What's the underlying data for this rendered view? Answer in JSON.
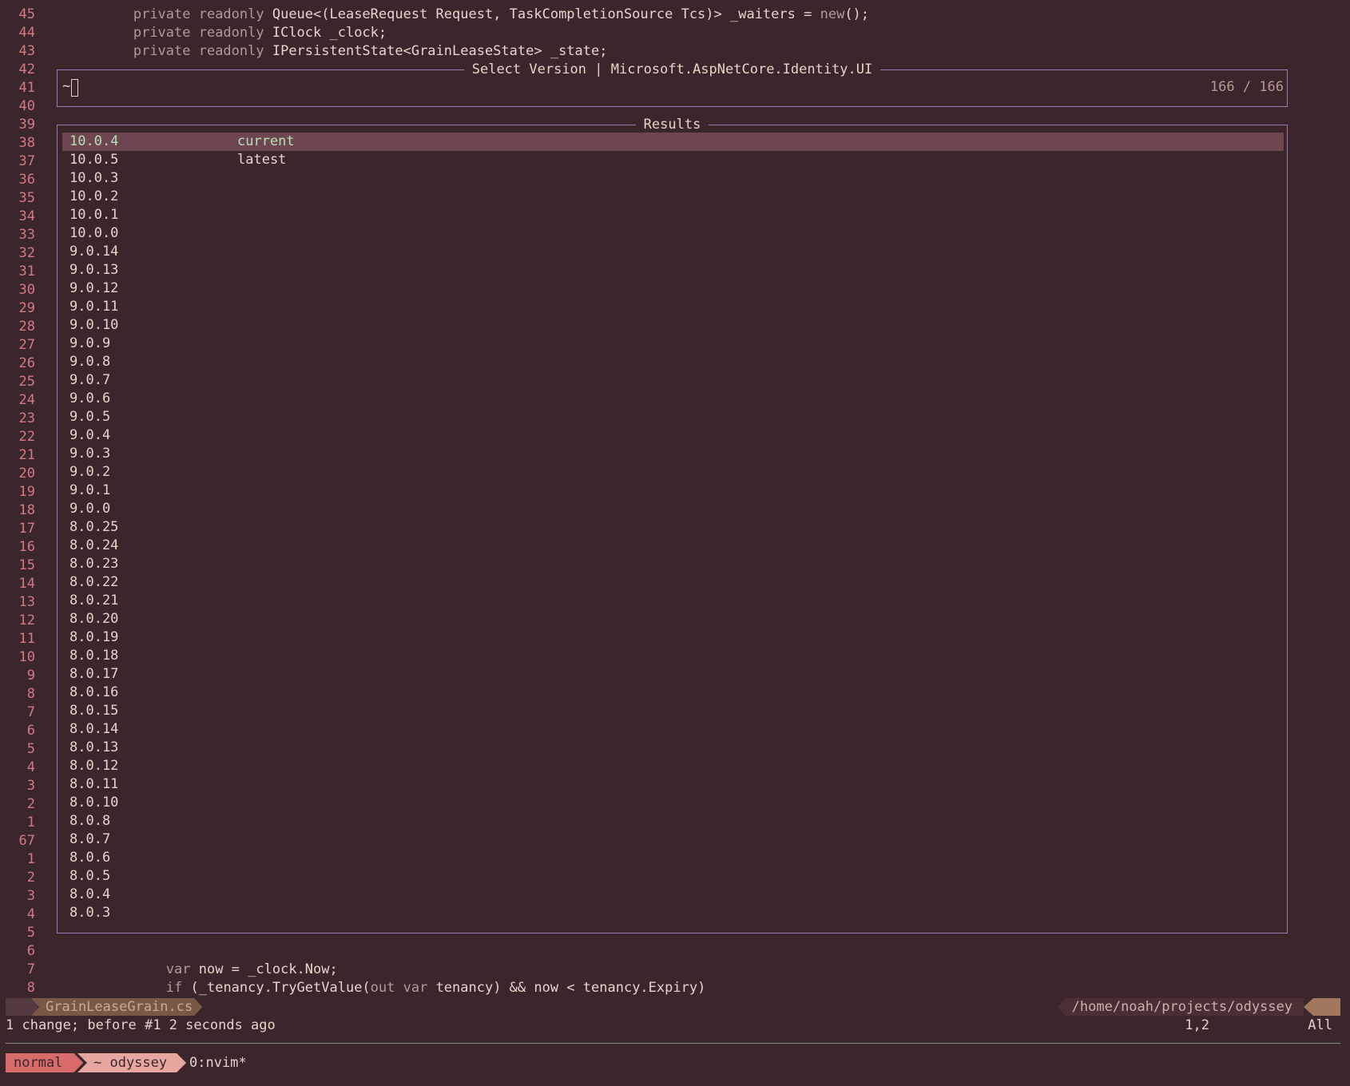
{
  "editor": {
    "code_top": [
      {
        "ln": "45",
        "indent": "    ",
        "kw": "private readonly",
        "rest": " Queue<(LeaseRequest Request, TaskCompletionSource Tcs)> _waiters = ",
        "kw2": "new",
        "tail": "();"
      },
      {
        "ln": "44",
        "indent": "    ",
        "kw": "private readonly",
        "rest": " IClock _clock;",
        "kw2": "",
        "tail": ""
      },
      {
        "ln": "43",
        "indent": "    ",
        "kw": "private readonly",
        "rest": " IPersistentState<GrainLeaseState> _state;",
        "kw2": "",
        "tail": ""
      }
    ],
    "gutter": [
      "42",
      "41",
      "40",
      "39",
      "38",
      "37",
      "36",
      "35",
      "34",
      "33",
      "32",
      "31",
      "30",
      "29",
      "28",
      "27",
      "26",
      "25",
      "24",
      "23",
      "22",
      "21",
      "20",
      "19",
      "18",
      "17",
      "16",
      "15",
      "14",
      "13",
      "12",
      "11",
      "10",
      "9",
      "8",
      "7",
      "6",
      "5",
      "4",
      "3",
      "2",
      "1",
      "67",
      "1",
      "2",
      "3",
      "4",
      "5",
      "6"
    ],
    "code_bottom": [
      {
        "ln": "7",
        "indent": "        ",
        "kw": "var",
        "rest": " now = _clock.Now;",
        "kw2": "",
        "tail": ""
      },
      {
        "ln": "8",
        "indent": "        ",
        "kw": "if",
        "rest": " (_tenancy.TryGetValue(",
        "kw2": "out var",
        "tail": " tenancy) && now < tenancy.Expiry)"
      }
    ]
  },
  "picker": {
    "title": "Select Version | Microsoft.AspNetCore.Identity.UI",
    "prompt": "~",
    "counter": "166 / 166",
    "results_title": "Results",
    "results": [
      {
        "version": "10.0.4",
        "tag": "current",
        "selected": true
      },
      {
        "version": "10.0.5",
        "tag": "latest"
      },
      {
        "version": "10.0.3"
      },
      {
        "version": "10.0.2"
      },
      {
        "version": "10.0.1"
      },
      {
        "version": "10.0.0"
      },
      {
        "version": "9.0.14"
      },
      {
        "version": "9.0.13"
      },
      {
        "version": "9.0.12"
      },
      {
        "version": "9.0.11"
      },
      {
        "version": "9.0.10"
      },
      {
        "version": "9.0.9"
      },
      {
        "version": "9.0.8"
      },
      {
        "version": "9.0.7"
      },
      {
        "version": "9.0.6"
      },
      {
        "version": "9.0.5"
      },
      {
        "version": "9.0.4"
      },
      {
        "version": "9.0.3"
      },
      {
        "version": "9.0.2"
      },
      {
        "version": "9.0.1"
      },
      {
        "version": "9.0.0"
      },
      {
        "version": "8.0.25"
      },
      {
        "version": "8.0.24"
      },
      {
        "version": "8.0.23"
      },
      {
        "version": "8.0.22"
      },
      {
        "version": "8.0.21"
      },
      {
        "version": "8.0.20"
      },
      {
        "version": "8.0.19"
      },
      {
        "version": "8.0.18"
      },
      {
        "version": "8.0.17"
      },
      {
        "version": "8.0.16"
      },
      {
        "version": "8.0.15"
      },
      {
        "version": "8.0.14"
      },
      {
        "version": "8.0.13"
      },
      {
        "version": "8.0.12"
      },
      {
        "version": "8.0.11"
      },
      {
        "version": "8.0.10"
      },
      {
        "version": "8.0.8"
      },
      {
        "version": "8.0.7"
      },
      {
        "version": "8.0.6"
      },
      {
        "version": "8.0.5"
      },
      {
        "version": "8.0.4"
      },
      {
        "version": "8.0.3"
      }
    ]
  },
  "statusline": {
    "filename": "GrainLeaseGrain.cs",
    "path": "/home/noah/projects/odyssey"
  },
  "message": {
    "text": "1 change; before #1  2 seconds ago",
    "position": "1,2",
    "scroll": "All"
  },
  "tmux": {
    "mode": "normal",
    "session": "~ odyssey",
    "window": "0:nvim*"
  }
}
